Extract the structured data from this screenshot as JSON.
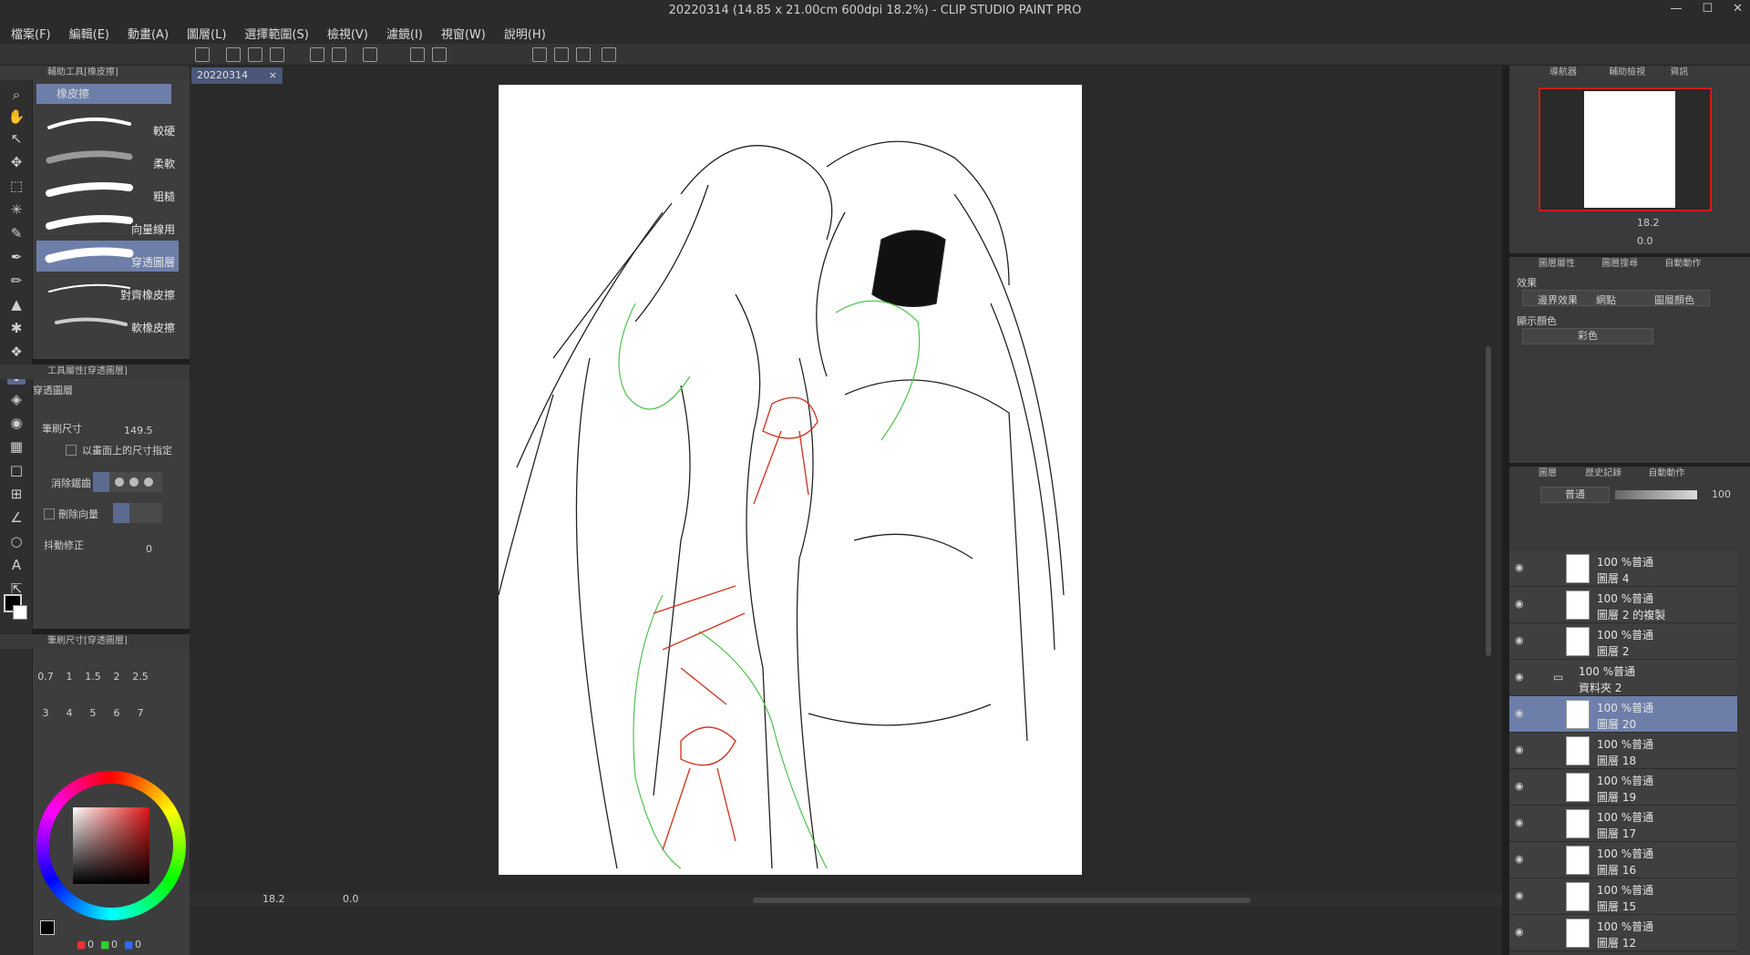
{
  "window": {
    "title": "20220314 (14.85 x 21.00cm 600dpi 18.2%)  - CLIP STUDIO PAINT PRO"
  },
  "menu": [
    "檔案(F)",
    "編輯(E)",
    "動畫(A)",
    "圖層(L)",
    "選擇範圍(S)",
    "檢視(V)",
    "濾鏡(I)",
    "視窗(W)",
    "說明(H)"
  ],
  "subtool": {
    "header": "輔助工具[橡皮擦]",
    "group": "橡皮擦",
    "brushes": [
      "較硬",
      "柔軟",
      "粗糙",
      "向量線用",
      "穿透圖層",
      "對齊橡皮擦",
      "軟橡皮擦"
    ]
  },
  "toolprop": {
    "header": "工具屬性[穿透圖層]",
    "name": "穿透圖層",
    "brush_size_label": "筆刷尺寸",
    "brush_size_value": "149.5",
    "screen_size_label": "以畫面上的尺寸指定",
    "antialias_label": "消除鋸齒",
    "delete_vector_label": "刪除向量",
    "stabilization_label": "抖動修正",
    "stabilization_value": "0"
  },
  "brushsize": {
    "header": "筆刷尺寸[穿透圖層]",
    "sizes": [
      "0.7",
      "1",
      "1.5",
      "2",
      "2.5",
      "3",
      "4",
      "5",
      "6",
      "7"
    ]
  },
  "color": {
    "r": "0",
    "g": "0",
    "b": "0",
    "main_color": "#000000",
    "sub_color": "#ffffff"
  },
  "document": {
    "tab": "20220314"
  },
  "statusbar": {
    "zoom": "18.2",
    "rotation": "0.0"
  },
  "navigator": {
    "tab1": "導航器",
    "tab2": "輔助檢視",
    "tab3": "資訊",
    "zoom": "18.2",
    "rotation": "0.0"
  },
  "layerprop": {
    "tab1": "圖層屬性",
    "tab2": "圖層搜尋",
    "tab3": "自動動作",
    "effect_label": "效果",
    "effect_border": "邊界效果",
    "effect_tone": "網點",
    "effect_layer_color": "圖層顏色",
    "display_color_label": "顯示顏色",
    "display_color_value": "彩色"
  },
  "layers": {
    "tab1": "圖層",
    "tab2": "歷史記錄",
    "tab3": "自動動作",
    "blend_mode": "普通",
    "opacity": "100",
    "rows": [
      {
        "mode": "100 %普通",
        "name": "圖層 4"
      },
      {
        "mode": "100 %普通",
        "name": "圖層 2 的複製"
      },
      {
        "mode": "100 %普通",
        "name": "圖層 2"
      },
      {
        "mode": "100 %普通",
        "name": "資料夾 2"
      },
      {
        "mode": "100 %普通",
        "name": "圖層 20"
      },
      {
        "mode": "100 %普通",
        "name": "圖層 18"
      },
      {
        "mode": "100 %普通",
        "name": "圖層 19"
      },
      {
        "mode": "100 %普通",
        "name": "圖層 17"
      },
      {
        "mode": "100 %普通",
        "name": "圖層 16"
      },
      {
        "mode": "100 %普通",
        "name": "圖層 15"
      },
      {
        "mode": "100 %普通",
        "name": "圖層 12"
      }
    ]
  },
  "colors": {
    "accent": "#6d7fa9",
    "panel": "#3d3d3d",
    "canvas_bg": "#2a2a2a",
    "nav_frame": "#d21b1b"
  }
}
